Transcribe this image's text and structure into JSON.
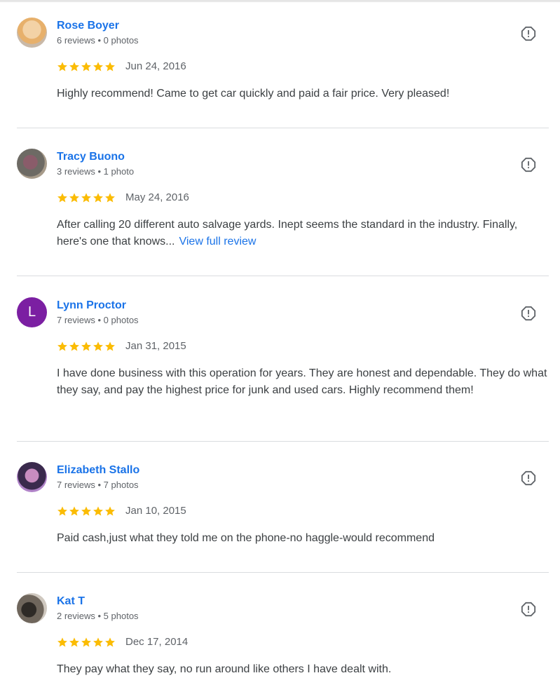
{
  "reviews": [
    {
      "name": "Rose Boyer",
      "meta": "6 reviews • 0 photos",
      "rating": 5,
      "date": "Jun 24, 2016",
      "text": "Highly recommend! Came to get car quickly and paid a fair price. Very pleased!",
      "more": ""
    },
    {
      "name": "Tracy Buono",
      "meta": "3 reviews • 1 photo",
      "rating": 5,
      "date": "May 24, 2016",
      "text": "After calling 20 different auto salvage yards. Inept seems the standard in the industry. Finally, here's one that knows...",
      "more": "View full review"
    },
    {
      "name": "Lynn Proctor",
      "avatar_letter": "L",
      "meta": "7 reviews • 0 photos",
      "rating": 5,
      "date": "Jan 31, 2015",
      "text": "I have done business with this operation for years. They are honest and dependable. They do what they say, and pay the highest price for junk and used cars. Highly recommend them!",
      "more": ""
    },
    {
      "name": "Elizabeth Stallo",
      "meta": "7 reviews • 7 photos",
      "rating": 5,
      "date": "Jan 10, 2015",
      "text": "Paid cash,just what they told me on the phone-no haggle-would recommend",
      "more": ""
    },
    {
      "name": "Kat T",
      "meta": "2 reviews • 5 photos",
      "rating": 5,
      "date": "Dec 17, 2014",
      "text": "They pay what they say, no run around like others I have dealt with.",
      "more": ""
    }
  ],
  "colors": {
    "link": "#1a73e8",
    "star": "#fbbc04",
    "avatar_letter_bg": "#7b1fa2"
  },
  "icons": {
    "flag": "report-octagon-icon",
    "star": "star-icon"
  }
}
